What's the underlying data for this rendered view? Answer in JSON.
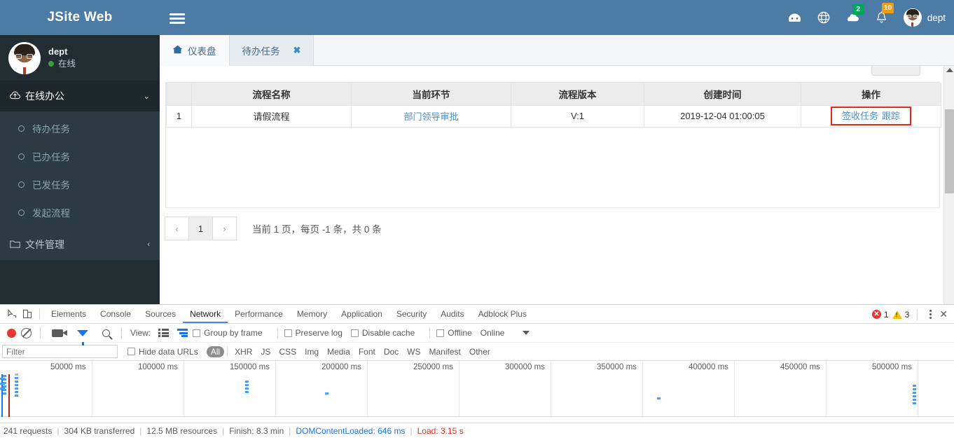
{
  "brand": {
    "title": "JSite Web"
  },
  "user_panel": {
    "name": "dept",
    "status": "在线"
  },
  "sidebar": {
    "group": {
      "label": "在线办公",
      "icon": "cloud-upload-icon",
      "caret": "chevron-down-icon"
    },
    "items": [
      {
        "label": "待办任务"
      },
      {
        "label": "已办任务"
      },
      {
        "label": "已发任务"
      },
      {
        "label": "发起流程"
      }
    ],
    "second_group": {
      "label": "文件管理",
      "icon": "folder-icon",
      "caret": "chevron-left-icon"
    }
  },
  "topbar": {
    "menu_toggle": "hamburger-icon",
    "icons": [
      {
        "name": "dashboard-icon",
        "glyph": "◕",
        "badge": null
      },
      {
        "name": "globe-icon",
        "glyph": "⊕",
        "badge": null
      },
      {
        "name": "messages-icon",
        "glyph": "☁",
        "badge": "2",
        "badge_color": "#00a65a"
      },
      {
        "name": "notifications-icon",
        "glyph": "🔔",
        "badge": "10",
        "badge_color": "#f39c12"
      }
    ],
    "user_label": "dept"
  },
  "tabs": [
    {
      "label": "仪表盘",
      "icon": "home-icon",
      "active": false,
      "closable": false
    },
    {
      "label": "待办任务",
      "icon": null,
      "active": true,
      "closable": true,
      "close_glyph": "✖"
    }
  ],
  "table": {
    "headers": [
      "",
      "流程名称",
      "当前环节",
      "流程版本",
      "创建时间",
      "操作"
    ],
    "rows": [
      {
        "index": "1",
        "process_name": "请假流程",
        "current_step": "部门领导审批",
        "version": "V:1",
        "created_at": "2019-12-04 01:00:05",
        "actions": [
          "签收任务",
          "跟踪"
        ]
      }
    ]
  },
  "pagination": {
    "prev": "‹",
    "pages": [
      "1"
    ],
    "next": "›",
    "info_prefix": "当前",
    "current_page": "1",
    "info_mid1": "页，每页",
    "page_size": "-1",
    "info_mid2": "条，共",
    "total": "0",
    "info_suffix": "条"
  },
  "devtools": {
    "left_icons": [
      {
        "name": "inspect-element-icon"
      },
      {
        "name": "device-toolbar-icon"
      }
    ],
    "tabs": [
      {
        "label": "Elements",
        "active": false
      },
      {
        "label": "Console",
        "active": false
      },
      {
        "label": "Sources",
        "active": false
      },
      {
        "label": "Network",
        "active": true
      },
      {
        "label": "Performance",
        "active": false
      },
      {
        "label": "Memory",
        "active": false
      },
      {
        "label": "Application",
        "active": false
      },
      {
        "label": "Security",
        "active": false
      },
      {
        "label": "Audits",
        "active": false
      },
      {
        "label": "Adblock Plus",
        "active": false
      }
    ],
    "error_count": "1",
    "warning_count": "3",
    "close_glyph": "✕",
    "toolbar": {
      "record_title": "record-button",
      "clear_title": "clear-button",
      "view_label": "View:",
      "group_by_frame": "Group by frame",
      "preserve_log": "Preserve log",
      "disable_cache": "Disable cache",
      "offline": "Offline",
      "throttling": "Online"
    },
    "filter": {
      "placeholder": "Filter",
      "value": "",
      "hide_data_urls": "Hide data URLs",
      "types": [
        "All",
        "XHR",
        "JS",
        "CSS",
        "Img",
        "Media",
        "Font",
        "Doc",
        "WS",
        "Manifest",
        "Other"
      ],
      "active_type": "All"
    },
    "timeline": {
      "ticks": [
        "50000 ms",
        "100000 ms",
        "150000 ms",
        "200000 ms",
        "250000 ms",
        "300000 ms",
        "350000 ms",
        "400000 ms",
        "450000 ms",
        "500000 ms"
      ]
    },
    "status": {
      "requests": "241 requests",
      "transferred": "304 KB transferred",
      "resources": "12.5 MB resources",
      "finish": "Finish: 8.3 min",
      "dom_content_loaded": "DOMContentLoaded: 646 ms",
      "load": "Load: 3.15 s",
      "separator": "|"
    }
  },
  "colors": {
    "brand_blue": "#4c7ba6",
    "sidebar_dark": "#222d32",
    "link_blue": "#4a90c4",
    "highlight_red": "#e8271c",
    "badge_green": "#00a65a",
    "badge_yellow": "#f39c12"
  }
}
